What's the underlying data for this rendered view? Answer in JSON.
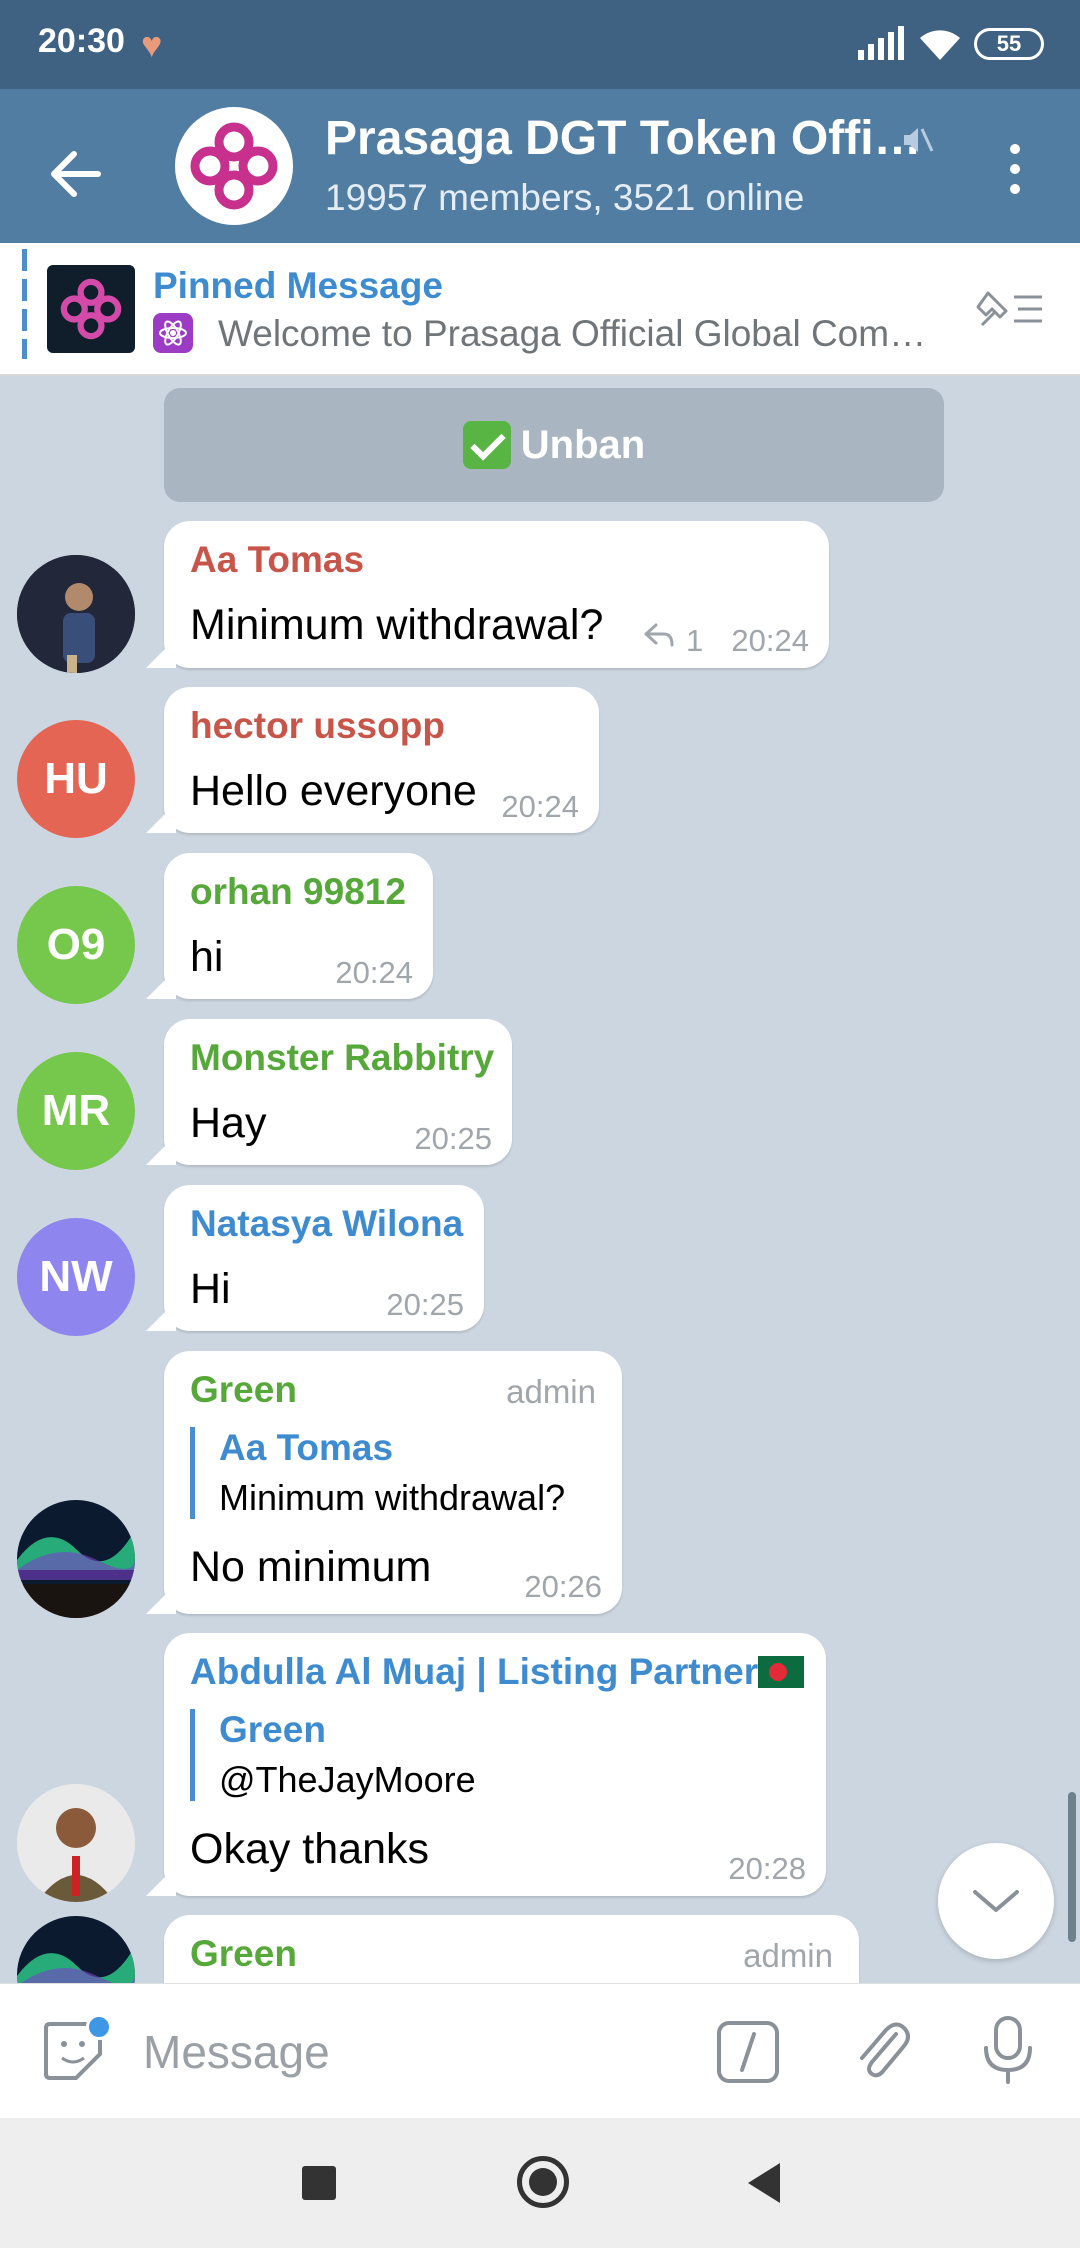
{
  "status_bar": {
    "time": "20:30",
    "battery": "55"
  },
  "header": {
    "title": "Prasaga DGT Token Offi…",
    "subtitle": "19957 members, 3521 online"
  },
  "pinned": {
    "title": "Pinned Message",
    "text": "Welcome to Prasaga Official Global Com…"
  },
  "unban": {
    "label": "Unban"
  },
  "messages": [
    {
      "sender": "Aa Tomas",
      "sender_color": "#c8554a",
      "text": "Minimum withdrawal?",
      "time": "20:24",
      "reply_count": "1"
    },
    {
      "sender": "hector ussopp",
      "sender_color": "#c8554a",
      "text": "Hello everyone",
      "time": "20:24",
      "avatar_initials": "HU",
      "avatar_color": "#e56555"
    },
    {
      "sender": "orhan 99812",
      "sender_color": "#56a83a",
      "text": "hi",
      "time": "20:24",
      "avatar_initials": "O9",
      "avatar_color": "#76c84d"
    },
    {
      "sender": "Monster Rabbitry",
      "sender_color": "#56a83a",
      "text": "Hay",
      "time": "20:25",
      "avatar_initials": "MR",
      "avatar_color": "#76c84d"
    },
    {
      "sender": "Natasya Wilona",
      "sender_color": "#3e8ccf",
      "text": "Hi",
      "time": "20:25",
      "avatar_initials": "NW",
      "avatar_color": "#8e85ee"
    },
    {
      "sender": "Green",
      "sender_color": "#56a83a",
      "tag": "admin",
      "reply_to_name": "Aa Tomas",
      "reply_to_text": "Minimum withdrawal?",
      "text": "No minimum",
      "time": "20:26"
    },
    {
      "sender": "Abdulla Al Muaj | Listing Partner",
      "sender_color": "#3e8ccf",
      "reply_to_name": "Green",
      "reply_to_text": "@TheJayMoore",
      "text": "Okay thanks",
      "time": "20:28"
    },
    {
      "sender": "Green",
      "sender_color": "#56a83a",
      "tag": "admin"
    }
  ],
  "composer": {
    "placeholder": "Message"
  },
  "colors": {
    "header": "#527da3",
    "status_bar": "#3f6283",
    "chat_bg": "#ccd6e0",
    "accent": "#3e8ccf"
  }
}
